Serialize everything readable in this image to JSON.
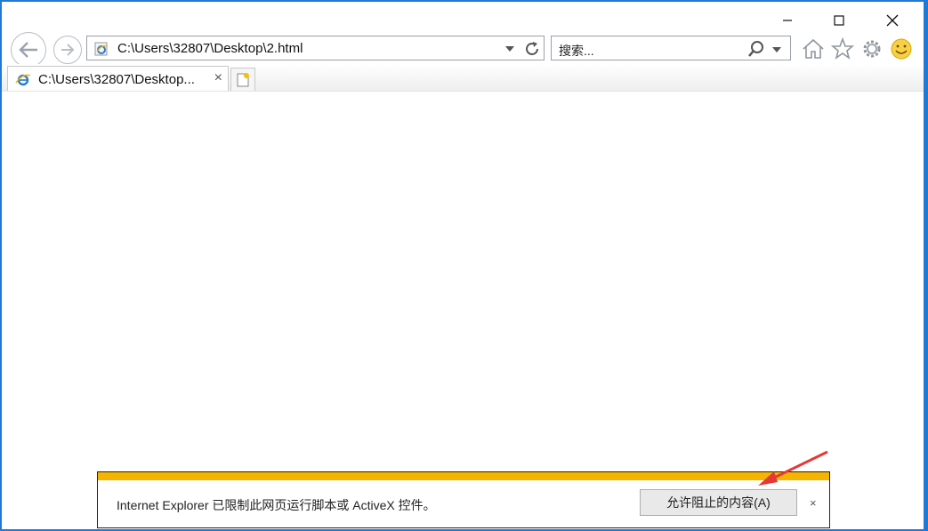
{
  "window": {
    "caption": {
      "minimize": "minimize",
      "maximize": "maximize",
      "close": "close"
    }
  },
  "nav": {
    "address": "C:\\Users\\32807\\Desktop\\2.html",
    "search_placeholder": "搜索..."
  },
  "tab": {
    "title": "C:\\Users\\32807\\Desktop...",
    "close_label": "×"
  },
  "notification": {
    "message": "Internet Explorer 已限制此网页运行脚本或 ActiveX 控件。",
    "button_label": "允许阻止的内容(A)",
    "close_label": "×",
    "accent_color": "#f4b400"
  },
  "colors": {
    "desktop": "#1e7ad6",
    "annotation_arrow": "#e53935"
  },
  "icons": [
    "back-icon",
    "forward-icon",
    "ie-page-icon",
    "refresh-icon",
    "search-icon",
    "home-icon",
    "favorites-icon",
    "settings-icon",
    "smiley-icon",
    "new-tab-icon"
  ]
}
